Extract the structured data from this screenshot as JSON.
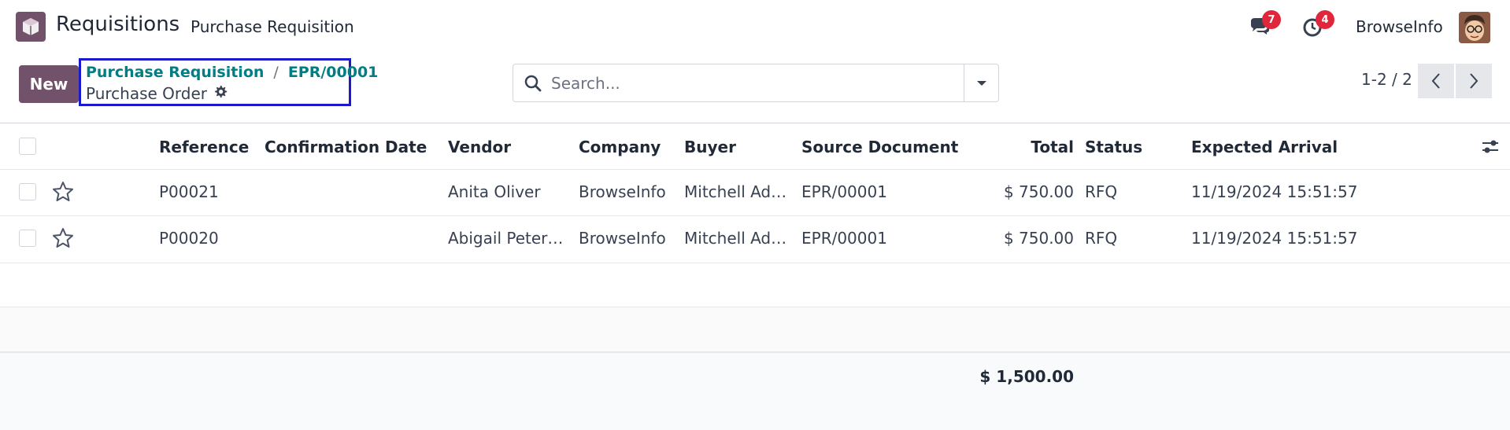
{
  "navbar": {
    "app_name": "Requisitions",
    "menu_item": "Purchase Requisition",
    "messages_count": "7",
    "activities_count": "4",
    "company": "BrowseInfo"
  },
  "control": {
    "new_label": "New",
    "breadcrumb_parent": "Purchase Requisition",
    "breadcrumb_separator": "/",
    "breadcrumb_record": "EPR/00001",
    "current_view": "Purchase Order",
    "search_placeholder": "Search...",
    "pager": "1-2 / 2"
  },
  "table": {
    "columns": {
      "reference": "Reference",
      "confirmation_date": "Confirmation Date",
      "vendor": "Vendor",
      "company": "Company",
      "buyer": "Buyer",
      "source_document": "Source Document",
      "total": "Total",
      "status": "Status",
      "expected_arrival": "Expected Arrival"
    },
    "rows": [
      {
        "reference": "P00021",
        "confirmation_date": "",
        "vendor": "Anita Oliver",
        "company": "BrowseInfo",
        "buyer": "Mitchell Ad…",
        "source_document": "EPR/00001",
        "total": "$ 750.00",
        "status": "RFQ",
        "expected_arrival": "11/19/2024 15:51:57"
      },
      {
        "reference": "P00020",
        "confirmation_date": "",
        "vendor": "Abigail Peter…",
        "company": "BrowseInfo",
        "buyer": "Mitchell Ad…",
        "source_document": "EPR/00001",
        "total": "$ 750.00",
        "status": "RFQ",
        "expected_arrival": "11/19/2024 15:51:57"
      }
    ],
    "grand_total": "$ 1,500.00"
  },
  "colors": {
    "brand": "#71526a",
    "link": "#017e84",
    "badge": "#e0263b",
    "highlight_border": "#1a1acc"
  }
}
